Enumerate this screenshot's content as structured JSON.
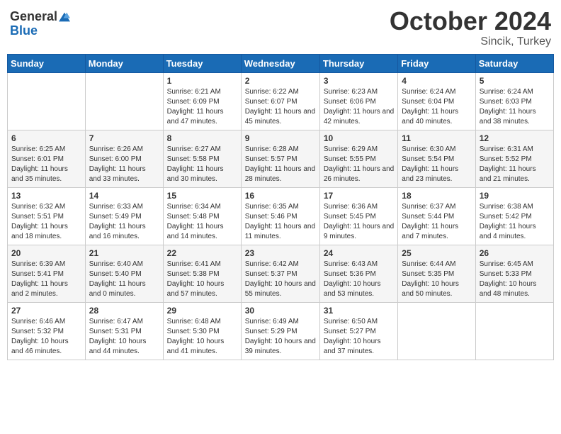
{
  "header": {
    "logo_general": "General",
    "logo_blue": "Blue",
    "month_title": "October 2024",
    "location": "Sincik, Turkey"
  },
  "days_of_week": [
    "Sunday",
    "Monday",
    "Tuesday",
    "Wednesday",
    "Thursday",
    "Friday",
    "Saturday"
  ],
  "weeks": [
    [
      {
        "day": "",
        "content": ""
      },
      {
        "day": "",
        "content": ""
      },
      {
        "day": "1",
        "content": "Sunrise: 6:21 AM\nSunset: 6:09 PM\nDaylight: 11 hours and 47 minutes."
      },
      {
        "day": "2",
        "content": "Sunrise: 6:22 AM\nSunset: 6:07 PM\nDaylight: 11 hours and 45 minutes."
      },
      {
        "day": "3",
        "content": "Sunrise: 6:23 AM\nSunset: 6:06 PM\nDaylight: 11 hours and 42 minutes."
      },
      {
        "day": "4",
        "content": "Sunrise: 6:24 AM\nSunset: 6:04 PM\nDaylight: 11 hours and 40 minutes."
      },
      {
        "day": "5",
        "content": "Sunrise: 6:24 AM\nSunset: 6:03 PM\nDaylight: 11 hours and 38 minutes."
      }
    ],
    [
      {
        "day": "6",
        "content": "Sunrise: 6:25 AM\nSunset: 6:01 PM\nDaylight: 11 hours and 35 minutes."
      },
      {
        "day": "7",
        "content": "Sunrise: 6:26 AM\nSunset: 6:00 PM\nDaylight: 11 hours and 33 minutes."
      },
      {
        "day": "8",
        "content": "Sunrise: 6:27 AM\nSunset: 5:58 PM\nDaylight: 11 hours and 30 minutes."
      },
      {
        "day": "9",
        "content": "Sunrise: 6:28 AM\nSunset: 5:57 PM\nDaylight: 11 hours and 28 minutes."
      },
      {
        "day": "10",
        "content": "Sunrise: 6:29 AM\nSunset: 5:55 PM\nDaylight: 11 hours and 26 minutes."
      },
      {
        "day": "11",
        "content": "Sunrise: 6:30 AM\nSunset: 5:54 PM\nDaylight: 11 hours and 23 minutes."
      },
      {
        "day": "12",
        "content": "Sunrise: 6:31 AM\nSunset: 5:52 PM\nDaylight: 11 hours and 21 minutes."
      }
    ],
    [
      {
        "day": "13",
        "content": "Sunrise: 6:32 AM\nSunset: 5:51 PM\nDaylight: 11 hours and 18 minutes."
      },
      {
        "day": "14",
        "content": "Sunrise: 6:33 AM\nSunset: 5:49 PM\nDaylight: 11 hours and 16 minutes."
      },
      {
        "day": "15",
        "content": "Sunrise: 6:34 AM\nSunset: 5:48 PM\nDaylight: 11 hours and 14 minutes."
      },
      {
        "day": "16",
        "content": "Sunrise: 6:35 AM\nSunset: 5:46 PM\nDaylight: 11 hours and 11 minutes."
      },
      {
        "day": "17",
        "content": "Sunrise: 6:36 AM\nSunset: 5:45 PM\nDaylight: 11 hours and 9 minutes."
      },
      {
        "day": "18",
        "content": "Sunrise: 6:37 AM\nSunset: 5:44 PM\nDaylight: 11 hours and 7 minutes."
      },
      {
        "day": "19",
        "content": "Sunrise: 6:38 AM\nSunset: 5:42 PM\nDaylight: 11 hours and 4 minutes."
      }
    ],
    [
      {
        "day": "20",
        "content": "Sunrise: 6:39 AM\nSunset: 5:41 PM\nDaylight: 11 hours and 2 minutes."
      },
      {
        "day": "21",
        "content": "Sunrise: 6:40 AM\nSunset: 5:40 PM\nDaylight: 11 hours and 0 minutes."
      },
      {
        "day": "22",
        "content": "Sunrise: 6:41 AM\nSunset: 5:38 PM\nDaylight: 10 hours and 57 minutes."
      },
      {
        "day": "23",
        "content": "Sunrise: 6:42 AM\nSunset: 5:37 PM\nDaylight: 10 hours and 55 minutes."
      },
      {
        "day": "24",
        "content": "Sunrise: 6:43 AM\nSunset: 5:36 PM\nDaylight: 10 hours and 53 minutes."
      },
      {
        "day": "25",
        "content": "Sunrise: 6:44 AM\nSunset: 5:35 PM\nDaylight: 10 hours and 50 minutes."
      },
      {
        "day": "26",
        "content": "Sunrise: 6:45 AM\nSunset: 5:33 PM\nDaylight: 10 hours and 48 minutes."
      }
    ],
    [
      {
        "day": "27",
        "content": "Sunrise: 6:46 AM\nSunset: 5:32 PM\nDaylight: 10 hours and 46 minutes."
      },
      {
        "day": "28",
        "content": "Sunrise: 6:47 AM\nSunset: 5:31 PM\nDaylight: 10 hours and 44 minutes."
      },
      {
        "day": "29",
        "content": "Sunrise: 6:48 AM\nSunset: 5:30 PM\nDaylight: 10 hours and 41 minutes."
      },
      {
        "day": "30",
        "content": "Sunrise: 6:49 AM\nSunset: 5:29 PM\nDaylight: 10 hours and 39 minutes."
      },
      {
        "day": "31",
        "content": "Sunrise: 6:50 AM\nSunset: 5:27 PM\nDaylight: 10 hours and 37 minutes."
      },
      {
        "day": "",
        "content": ""
      },
      {
        "day": "",
        "content": ""
      }
    ]
  ]
}
